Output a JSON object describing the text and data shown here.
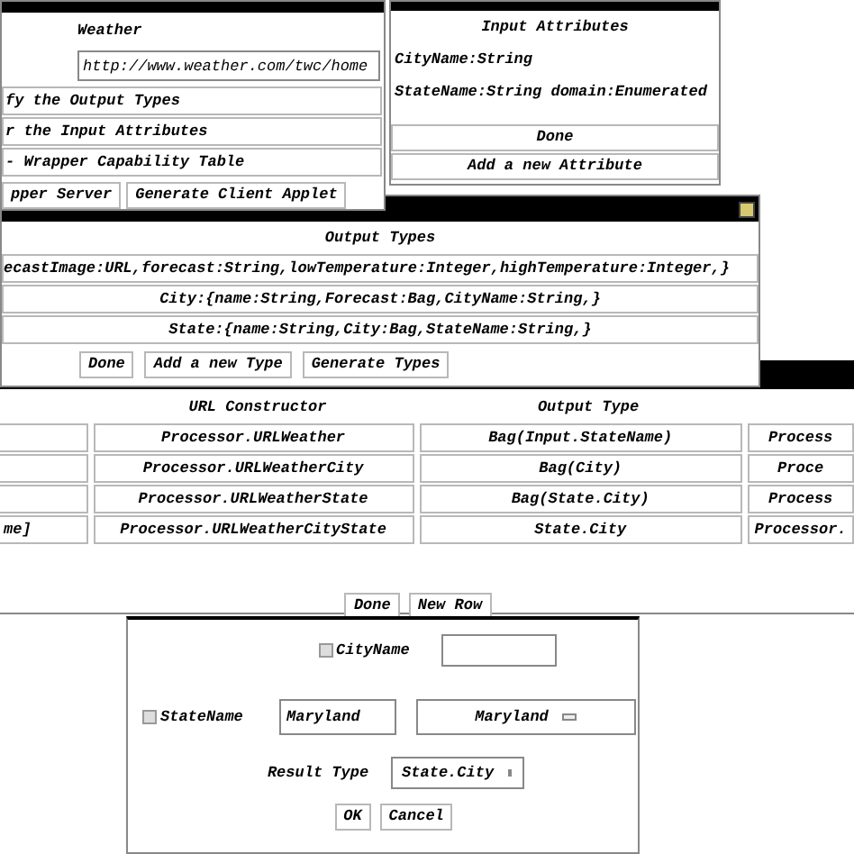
{
  "wrapper_window": {
    "title_label": "Weather",
    "url_field": {
      "value": "http://www.weather.com/twc/home"
    },
    "menu_rows": [
      "fy the Output Types",
      "r the Input Attributes",
      "- Wrapper Capability Table"
    ],
    "buttons": [
      "pper Server",
      "Generate Client Applet"
    ]
  },
  "input_attributes_window": {
    "title": "Input Attributes",
    "attributes": [
      "CityName:String",
      "StateName:String domain:Enumerated"
    ],
    "buttons": [
      "Done",
      "Add a new Attribute"
    ]
  },
  "output_types_window": {
    "title": "Output Types",
    "types": [
      "ecastImage:URL,forecast:String,lowTemperature:Integer,highTemperature:Integer,}",
      "City:{name:String,Forecast:Bag,CityName:String,}",
      "State:{name:String,City:Bag,StateName:String,}"
    ],
    "buttons": [
      "Done",
      "Add a new Type",
      "Generate Types"
    ]
  },
  "capability_table": {
    "columns": [
      "URL Constructor",
      "Output Type"
    ],
    "rows": [
      {
        "url_constructor": "Processor.URLWeather",
        "output_type": "Bag(Input.StateName)",
        "column_4": "Process"
      },
      {
        "url_constructor": "Processor.URLWeatherCity",
        "output_type": "Bag(City)",
        "column_4": "Proce"
      },
      {
        "url_constructor": "Processor.URLWeatherState",
        "output_type": "Bag(State.City)",
        "column_4": "Process"
      },
      {
        "column_1": "me]",
        "url_constructor": "Processor.URLWeatherCityState",
        "output_type": "State.City",
        "column_4": "Processor."
      }
    ],
    "buttons": [
      "Done",
      "New Row"
    ]
  },
  "query_dialog": {
    "city": {
      "label": "CityName",
      "checked": false
    },
    "state": {
      "label": "StateName",
      "checked": false,
      "value": "Maryland",
      "dropdown": "Maryland"
    },
    "result_type": {
      "label": "Result Type",
      "dropdown": "State.City"
    },
    "buttons": [
      "OK",
      "Cancel"
    ]
  }
}
